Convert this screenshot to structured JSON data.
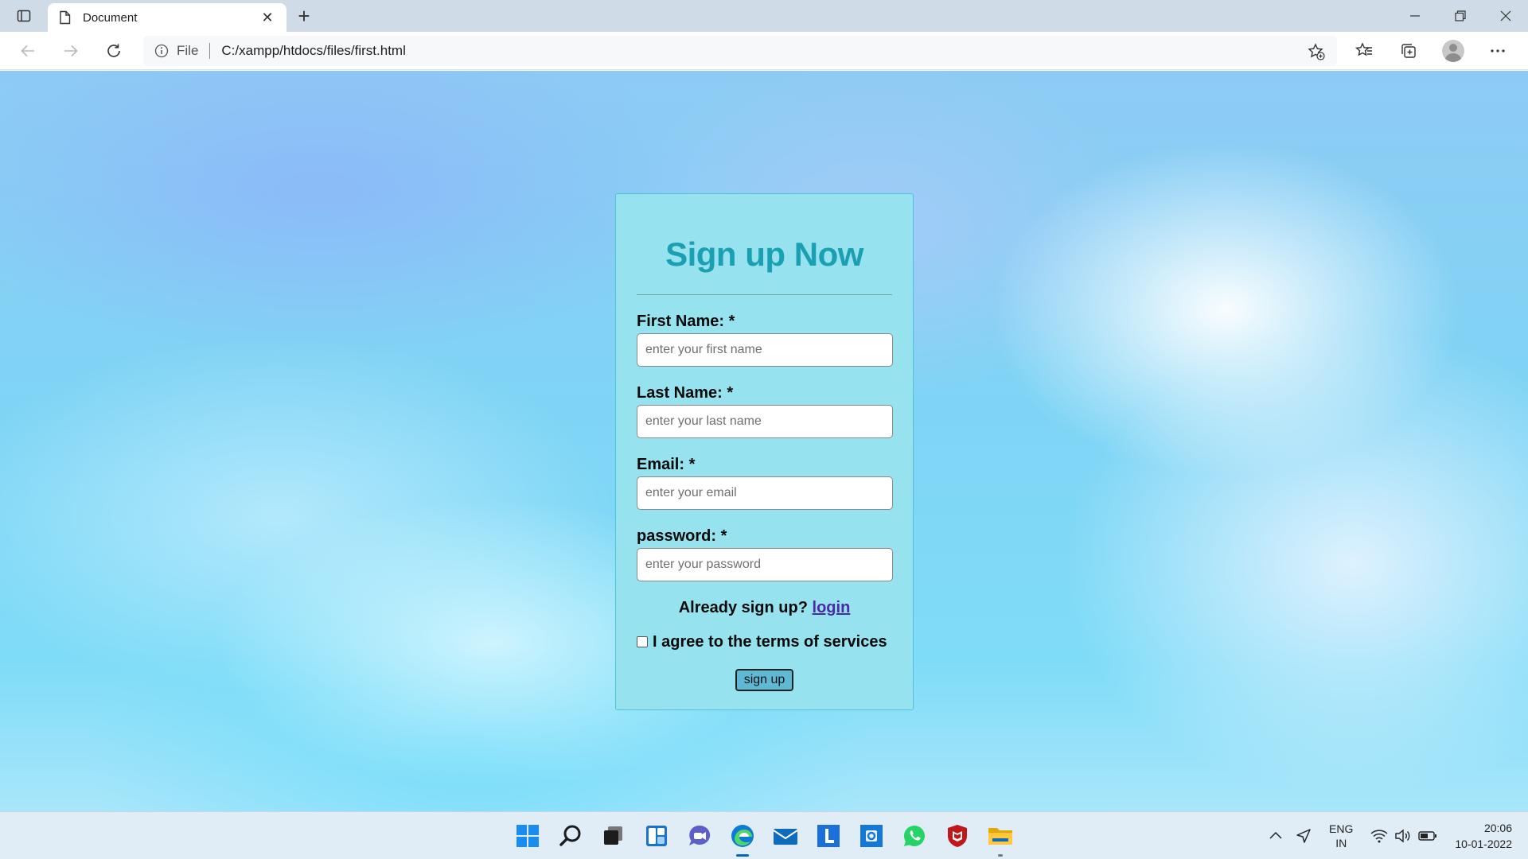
{
  "browser": {
    "tab_title": "Document",
    "tab_close": "✕",
    "new_tab": "+",
    "address_info_label": "File",
    "url": "C:/xampp/htdocs/files/first.html",
    "window_controls": {
      "minimize": "—",
      "restore": "❐",
      "close": "✕"
    }
  },
  "form": {
    "title": "Sign up Now",
    "fields": [
      {
        "label": "First Name: *",
        "placeholder": "enter your first name",
        "type": "text"
      },
      {
        "label": "Last Name: *",
        "placeholder": "enter your last name",
        "type": "text"
      },
      {
        "label": "Email: *",
        "placeholder": "enter your email",
        "type": "email"
      },
      {
        "label": "password: *",
        "placeholder": "enter your password",
        "type": "password"
      }
    ],
    "signin_prompt": "Already sign up?",
    "signin_link": "login",
    "terms_label": "I agree to the terms of services",
    "terms_checked": false,
    "submit_label": "sign up"
  },
  "taskbar": {
    "apps": [
      "start-icon",
      "search-icon",
      "task-view-icon",
      "widgets-icon",
      "teams-chat-icon",
      "edge-icon",
      "mail-icon",
      "l-app-icon",
      "outlook-icon",
      "whatsapp-icon",
      "mcafee-icon",
      "file-explorer-icon"
    ],
    "lang_top": "ENG",
    "lang_bottom": "IN",
    "time": "20:06",
    "date": "10-01-2022"
  },
  "colors": {
    "card_bg": "#96e3ef",
    "title_color": "#1aa0b2",
    "link_color": "#4a2aa6",
    "button_bg": "#5fb8d4"
  }
}
